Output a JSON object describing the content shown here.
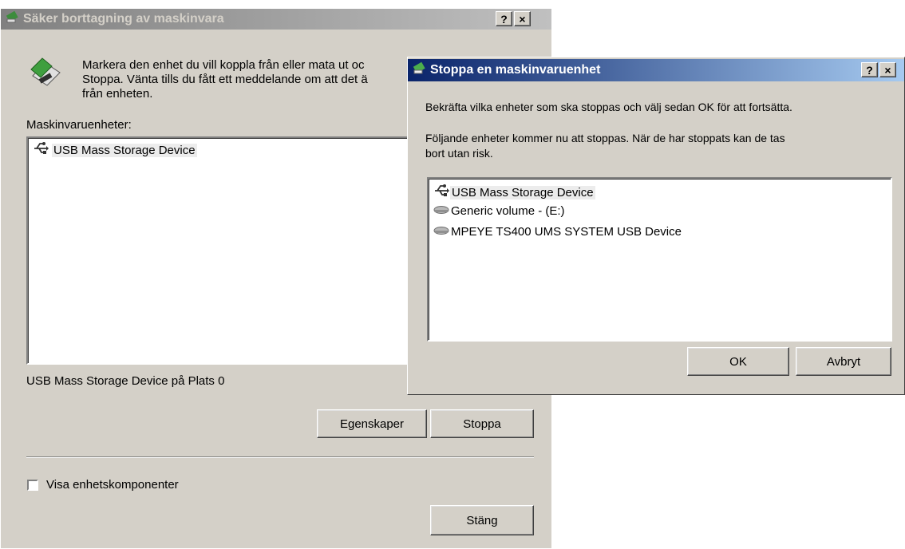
{
  "back_dialog": {
    "title": "Säker borttagning av maskinvara",
    "help_btn": "?",
    "close_btn": "×",
    "intro": [
      "Markera den enhet du vill koppla från eller mata ut oc",
      "Stoppa. Vänta tills du fått ett meddelande om att det ä",
      "från enheten."
    ],
    "list_label": "Maskinvaruenheter:",
    "devices": [
      "USB Mass Storage Device"
    ],
    "status": "USB Mass Storage Device på Plats 0",
    "properties_btn": "Egenskaper",
    "stop_btn": "Stoppa",
    "show_components": "Visa enhetskomponenter",
    "close_dialog_btn": "Stäng"
  },
  "front_dialog": {
    "title": "Stoppa en maskinvaruenhet",
    "help_btn": "?",
    "close_btn": "×",
    "line1": "Bekräfta vilka enheter som ska stoppas och välj sedan OK för att fortsätta.",
    "line2a": "Följande enheter kommer nu att stoppas. När de har stoppats kan de tas",
    "line2b": "bort utan risk.",
    "devices": [
      {
        "label": "USB Mass Storage Device",
        "icon": "usb-icon"
      },
      {
        "label": "Generic volume - (E:)",
        "icon": "drive-icon"
      },
      {
        "label": "MPEYE TS400 UMS SYSTEM USB Device",
        "icon": "drive-icon"
      }
    ],
    "ok_btn": "OK",
    "cancel_btn": "Avbryt"
  }
}
